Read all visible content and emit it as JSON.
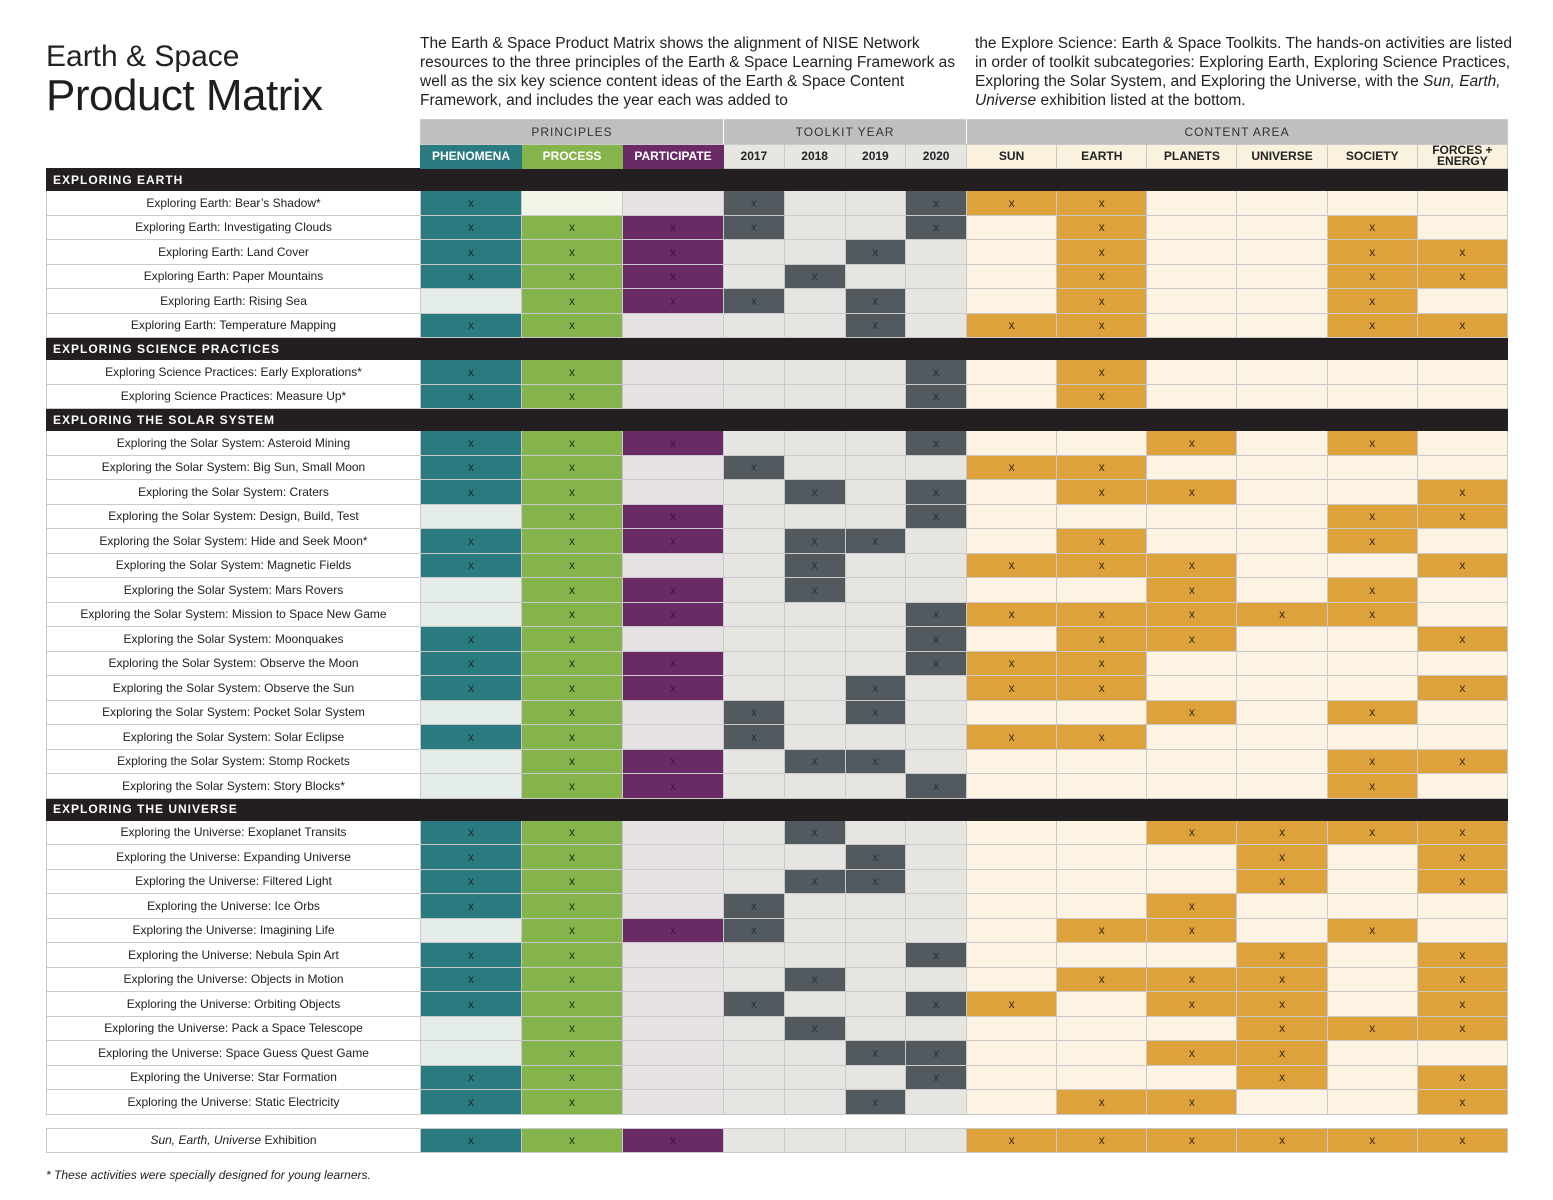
{
  "title": {
    "line1": "Earth & Space",
    "line2": "Product Matrix"
  },
  "intro": {
    "left": "The Earth & Space Product Matrix shows the alignment of NISE Network resources to the three principles of the Earth & Space Learning Framework as well as the six key science content ideas of the Earth & Space Content Framework, and includes the year each was added to",
    "right_before": "the Explore Science: Earth & Space Toolkits. The hands-on activities are listed in order of toolkit subcategories: Exploring Earth, Exploring Science Practices, Exploring the Solar System, and Exploring the Universe, with the ",
    "right_italic": "Sun, Earth, Universe",
    "right_after": " exhibition listed at the bottom."
  },
  "column_groups": [
    "PRINCIPLES",
    "TOOLKIT YEAR",
    "CONTENT AREA"
  ],
  "columns": [
    "PHENOMENA",
    "PROCESS",
    "PARTICIPATE",
    "2017",
    "2018",
    "2019",
    "2020",
    "SUN",
    "EARTH",
    "PLANETS",
    "UNIVERSE",
    "SOCIETY",
    "FORCES + ENERGY"
  ],
  "mark": "x",
  "colors": {
    "phenomena": "#2a7b80",
    "process": "#85b44c",
    "participate": "#6a2a68",
    "year": "#535a5f",
    "content": "#dda23c",
    "section_bar": "#231f20",
    "group_header": "#bfbfbf"
  },
  "sections": [
    {
      "name": "EXPLORING EARTH",
      "rows": [
        {
          "label": "Exploring Earth: Bear’s Shadow*",
          "marks": [
            1,
            0,
            0,
            1,
            0,
            0,
            1,
            1,
            1,
            0,
            0,
            0,
            0
          ]
        },
        {
          "label": "Exploring Earth: Investigating Clouds",
          "marks": [
            1,
            1,
            1,
            1,
            0,
            0,
            1,
            0,
            1,
            0,
            0,
            1,
            0
          ]
        },
        {
          "label": "Exploring Earth: Land Cover",
          "marks": [
            1,
            1,
            1,
            0,
            0,
            1,
            0,
            0,
            1,
            0,
            0,
            1,
            1
          ]
        },
        {
          "label": "Exploring Earth: Paper Mountains",
          "marks": [
            1,
            1,
            1,
            0,
            1,
            0,
            0,
            0,
            1,
            0,
            0,
            1,
            1
          ]
        },
        {
          "label": "Exploring Earth: Rising Sea",
          "marks": [
            0,
            1,
            1,
            1,
            0,
            1,
            0,
            0,
            1,
            0,
            0,
            1,
            0
          ]
        },
        {
          "label": "Exploring Earth: Temperature Mapping",
          "marks": [
            1,
            1,
            0,
            0,
            0,
            1,
            0,
            1,
            1,
            0,
            0,
            1,
            1
          ]
        }
      ]
    },
    {
      "name": "EXPLORING SCIENCE PRACTICES",
      "rows": [
        {
          "label": "Exploring Science Practices: Early Explorations*",
          "marks": [
            1,
            1,
            0,
            0,
            0,
            0,
            1,
            0,
            1,
            0,
            0,
            0,
            0
          ]
        },
        {
          "label": "Exploring Science Practices: Measure Up*",
          "marks": [
            1,
            1,
            0,
            0,
            0,
            0,
            1,
            0,
            1,
            0,
            0,
            0,
            0
          ]
        }
      ]
    },
    {
      "name": "EXPLORING THE SOLAR SYSTEM",
      "rows": [
        {
          "label": "Exploring the Solar System: Asteroid Mining",
          "marks": [
            1,
            1,
            1,
            0,
            0,
            0,
            1,
            0,
            0,
            1,
            0,
            1,
            0
          ]
        },
        {
          "label": "Exploring the Solar System: Big Sun, Small Moon",
          "marks": [
            1,
            1,
            0,
            1,
            0,
            0,
            0,
            1,
            1,
            0,
            0,
            0,
            0
          ]
        },
        {
          "label": "Exploring the Solar System: Craters",
          "marks": [
            1,
            1,
            0,
            0,
            1,
            0,
            1,
            0,
            1,
            1,
            0,
            0,
            1
          ]
        },
        {
          "label": "Exploring the Solar System: Design, Build, Test",
          "marks": [
            0,
            1,
            1,
            0,
            0,
            0,
            1,
            0,
            0,
            0,
            0,
            1,
            1
          ]
        },
        {
          "label": "Exploring the Solar System: Hide and Seek Moon*",
          "marks": [
            1,
            1,
            1,
            0,
            1,
            1,
            0,
            0,
            1,
            0,
            0,
            1,
            0
          ]
        },
        {
          "label": "Exploring the Solar System: Magnetic Fields",
          "marks": [
            1,
            1,
            0,
            0,
            1,
            0,
            0,
            1,
            1,
            1,
            0,
            0,
            1
          ]
        },
        {
          "label": "Exploring the Solar System: Mars Rovers",
          "marks": [
            0,
            1,
            1,
            0,
            1,
            0,
            0,
            0,
            0,
            1,
            0,
            1,
            0
          ]
        },
        {
          "label": "Exploring the Solar System: Mission to Space New Game",
          "marks": [
            0,
            1,
            1,
            0,
            0,
            0,
            1,
            1,
            1,
            1,
            1,
            1,
            0
          ]
        },
        {
          "label": "Exploring the Solar System: Moonquakes",
          "marks": [
            1,
            1,
            0,
            0,
            0,
            0,
            1,
            0,
            1,
            1,
            0,
            0,
            1
          ]
        },
        {
          "label": "Exploring the Solar System: Observe the Moon",
          "marks": [
            1,
            1,
            1,
            0,
            0,
            0,
            1,
            1,
            1,
            0,
            0,
            0,
            0
          ]
        },
        {
          "label": "Exploring the Solar System: Observe the Sun",
          "marks": [
            1,
            1,
            1,
            0,
            0,
            1,
            0,
            1,
            1,
            0,
            0,
            0,
            1
          ]
        },
        {
          "label": "Exploring the Solar System: Pocket Solar System",
          "marks": [
            0,
            1,
            0,
            1,
            0,
            1,
            0,
            0,
            0,
            1,
            0,
            1,
            0
          ]
        },
        {
          "label": "Exploring the Solar System: Solar Eclipse",
          "marks": [
            1,
            1,
            0,
            1,
            0,
            0,
            0,
            1,
            1,
            0,
            0,
            0,
            0
          ]
        },
        {
          "label": "Exploring the Solar System: Stomp Rockets",
          "marks": [
            0,
            1,
            1,
            0,
            1,
            1,
            0,
            0,
            0,
            0,
            0,
            1,
            1
          ]
        },
        {
          "label": "Exploring the Solar System: Story Blocks*",
          "marks": [
            0,
            1,
            1,
            0,
            0,
            0,
            1,
            0,
            0,
            0,
            0,
            1,
            0
          ]
        }
      ]
    },
    {
      "name": "EXPLORING THE UNIVERSE",
      "rows": [
        {
          "label": "Exploring the Universe: Exoplanet Transits",
          "marks": [
            1,
            1,
            0,
            0,
            1,
            0,
            0,
            0,
            0,
            1,
            1,
            1,
            1
          ]
        },
        {
          "label": "Exploring the Universe: Expanding Universe",
          "marks": [
            1,
            1,
            0,
            0,
            0,
            1,
            0,
            0,
            0,
            0,
            1,
            0,
            1
          ]
        },
        {
          "label": "Exploring the Universe: Filtered Light",
          "marks": [
            1,
            1,
            0,
            0,
            1,
            1,
            0,
            0,
            0,
            0,
            1,
            0,
            1
          ]
        },
        {
          "label": "Exploring the Universe: Ice Orbs",
          "marks": [
            1,
            1,
            0,
            1,
            0,
            0,
            0,
            0,
            0,
            1,
            0,
            0,
            0
          ]
        },
        {
          "label": "Exploring the Universe: Imagining Life",
          "marks": [
            0,
            1,
            1,
            1,
            0,
            0,
            0,
            0,
            1,
            1,
            0,
            1,
            0
          ]
        },
        {
          "label": "Exploring the Universe: Nebula Spin Art",
          "marks": [
            1,
            1,
            0,
            0,
            0,
            0,
            1,
            0,
            0,
            0,
            1,
            0,
            1
          ]
        },
        {
          "label": "Exploring the Universe: Objects in Motion",
          "marks": [
            1,
            1,
            0,
            0,
            1,
            0,
            0,
            0,
            1,
            1,
            1,
            0,
            1
          ]
        },
        {
          "label": "Exploring the Universe: Orbiting Objects",
          "marks": [
            1,
            1,
            0,
            1,
            0,
            0,
            1,
            1,
            0,
            1,
            1,
            0,
            1
          ]
        },
        {
          "label": "Exploring the Universe: Pack a Space Telescope",
          "marks": [
            0,
            1,
            0,
            0,
            1,
            0,
            0,
            0,
            0,
            0,
            1,
            1,
            1
          ]
        },
        {
          "label": "Exploring the Universe: Space Guess Quest Game",
          "marks": [
            0,
            1,
            0,
            0,
            0,
            1,
            1,
            0,
            0,
            1,
            1,
            0,
            0
          ]
        },
        {
          "label": "Exploring the Universe: Star Formation",
          "marks": [
            1,
            1,
            0,
            0,
            0,
            0,
            1,
            0,
            0,
            0,
            1,
            0,
            1
          ]
        },
        {
          "label": "Exploring the Universe: Static Electricity",
          "marks": [
            1,
            1,
            0,
            0,
            0,
            1,
            0,
            0,
            1,
            1,
            0,
            0,
            1
          ]
        }
      ]
    }
  ],
  "exhibition": {
    "label_italic": "Sun, Earth, Universe",
    "label_rest": " Exhibition",
    "marks": [
      1,
      1,
      1,
      0,
      0,
      0,
      0,
      1,
      1,
      1,
      1,
      1,
      1
    ]
  },
  "footnote": "* These activities were specially designed for young learners."
}
